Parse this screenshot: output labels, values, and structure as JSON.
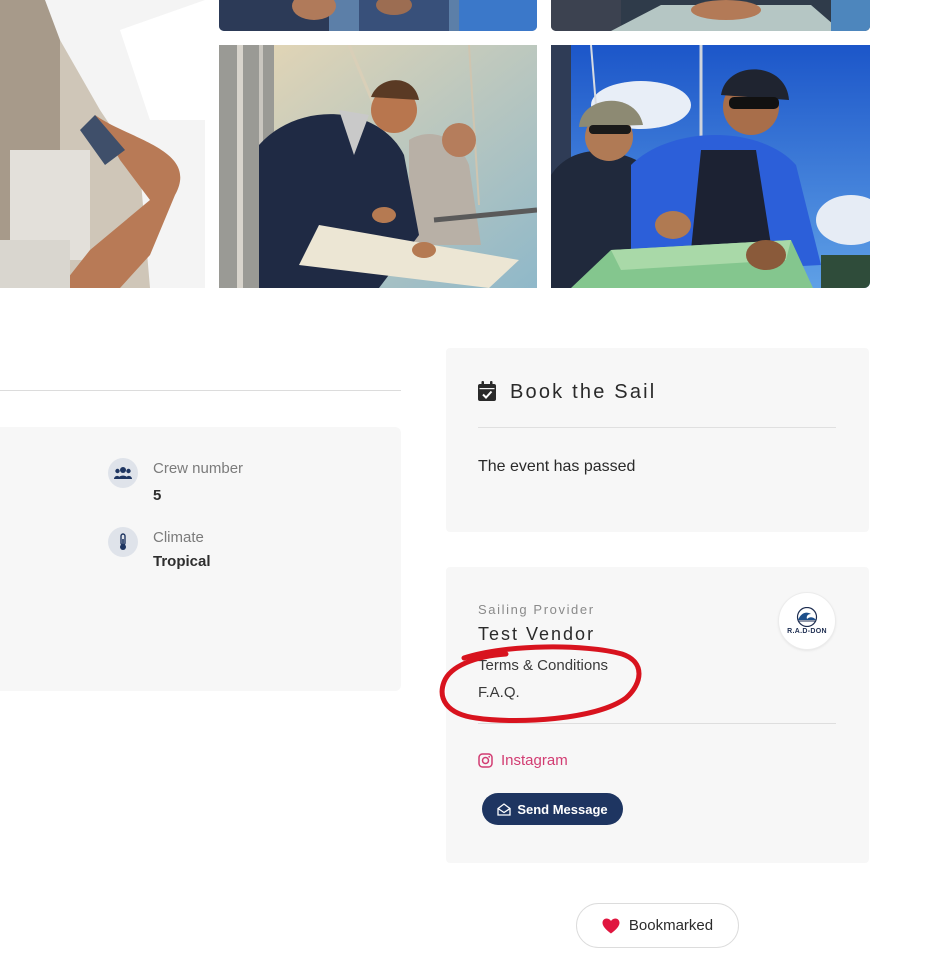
{
  "gallery": {
    "photos": [
      {
        "name": "gallery-photo-sailor-left",
        "subject": "sailor in white polo leaning over chart"
      },
      {
        "name": "gallery-photo-top-middle",
        "subject": "crew members (cropped)"
      },
      {
        "name": "gallery-photo-top-right",
        "subject": "hands on nautical chart (cropped)"
      },
      {
        "name": "gallery-photo-chart-reading",
        "subject": "two sailors reading a chart on deck"
      },
      {
        "name": "gallery-photo-map-planning",
        "subject": "two sailors in caps planning on a map"
      }
    ]
  },
  "details": {
    "crew": {
      "label": "Crew number",
      "value": "5",
      "icon": "users-icon"
    },
    "climate": {
      "label": "Climate",
      "value": "Tropical",
      "icon": "thermometer-icon"
    }
  },
  "booking": {
    "title": "Book the Sail",
    "icon": "calendar-check-icon",
    "status": "The event has passed"
  },
  "vendor": {
    "kicker": "Sailing Provider",
    "name": "Test Vendor",
    "links": [
      "Terms & Conditions",
      "F.A.Q."
    ],
    "logo_text": "R.A.D-DON",
    "instagram_label": "Instagram",
    "send_message_label": "Send Message"
  },
  "bookmark": {
    "label": "Bookmarked"
  },
  "colors": {
    "brand_navy": "#1e3561",
    "instagram_pink": "#d23c72",
    "heart_red": "#e0163f",
    "annotation_red": "#d8131e",
    "card_bg": "#f7f7f7"
  }
}
